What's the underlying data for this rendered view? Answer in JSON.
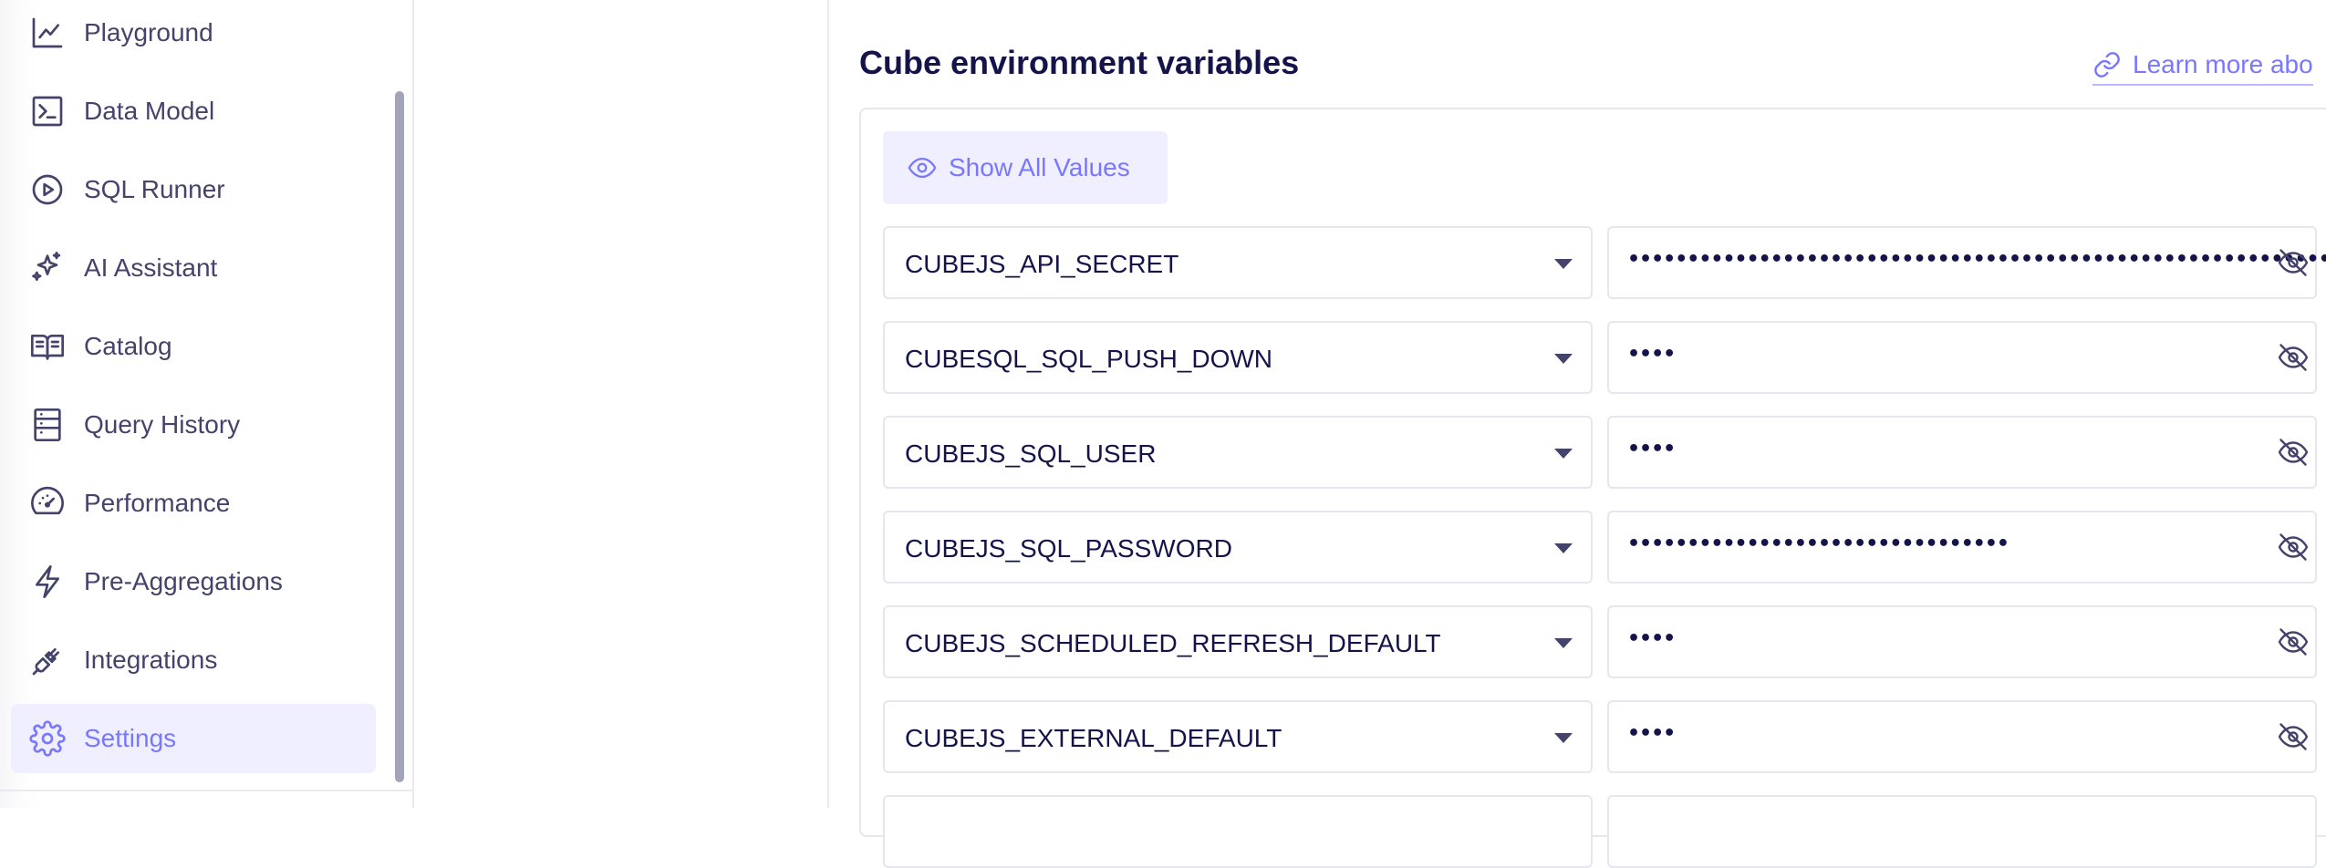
{
  "sidebar": {
    "items": [
      {
        "label": "Playground",
        "icon": "chart-line-icon"
      },
      {
        "label": "Data Model",
        "icon": "terminal-icon"
      },
      {
        "label": "SQL Runner",
        "icon": "play-circle-icon"
      },
      {
        "label": "AI Assistant",
        "icon": "sparkles-icon"
      },
      {
        "label": "Catalog",
        "icon": "book-icon"
      },
      {
        "label": "Query History",
        "icon": "list-icon"
      },
      {
        "label": "Performance",
        "icon": "gauge-icon"
      },
      {
        "label": "Pre-Aggregations",
        "icon": "lightning-icon"
      },
      {
        "label": "Integrations",
        "icon": "plug-icon"
      },
      {
        "label": "Settings",
        "icon": "gear-icon",
        "active": true
      }
    ]
  },
  "main": {
    "title": "Cube environment variables",
    "learn_more": "Learn more abo",
    "show_all_label": "Show All Values",
    "env_vars": [
      {
        "key": "CUBEJS_API_SECRET",
        "value": "••••••••••••••••••••••••••••••••••••••••••••••••••••••••••••••••"
      },
      {
        "key": "CUBESQL_SQL_PUSH_DOWN",
        "value": "••••"
      },
      {
        "key": "CUBEJS_SQL_USER",
        "value": "••••"
      },
      {
        "key": "CUBEJS_SQL_PASSWORD",
        "value": "••••••••••••••••••••••••••••••••"
      },
      {
        "key": "CUBEJS_SCHEDULED_REFRESH_DEFAULT",
        "value": "••••"
      },
      {
        "key": "CUBEJS_EXTERNAL_DEFAULT",
        "value": "••••"
      },
      {
        "key": "",
        "value": ""
      }
    ]
  },
  "colors": {
    "accent": "#7a77ff",
    "active_bg": "#efefff",
    "text_dark": "#14144b",
    "text_muted": "#43436b",
    "border": "#e6e6ef"
  }
}
